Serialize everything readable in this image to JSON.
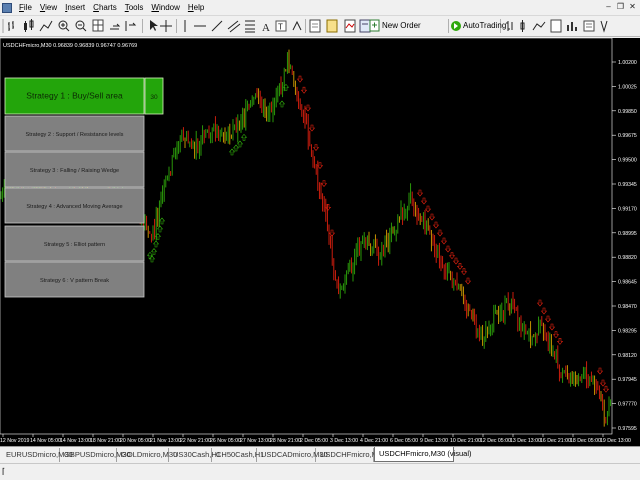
{
  "menu": {
    "items": [
      "File",
      "View",
      "Insert",
      "Charts",
      "Tools",
      "Window",
      "Help"
    ]
  },
  "toolbar": {
    "new_order_label": "New Order",
    "autotrading_label": "AutoTrading"
  },
  "chart": {
    "header_text": "USDCHFmicro,M30  0.96839 0.96839 0.96747 0.96769",
    "price_labels": [
      "1.00200",
      "1.00025",
      "0.99850",
      "0.99675",
      "0.99500",
      "0.99345",
      "0.99170",
      "0.98995",
      "0.98820",
      "0.98645",
      "0.98470",
      "0.98295",
      "0.98120",
      "0.97945",
      "0.97770",
      "0.97595"
    ],
    "time_labels": [
      "12 Nov 2019",
      "14 Nov 05:00",
      "14 Nov 13:00",
      "18 Nov 21:00",
      "20 Nov 05:00",
      "21 Nov 13:00",
      "22 Nov 21:00",
      "26 Nov 05:00",
      "27 Nov 13:00",
      "28 Nov 21:00",
      "2 Dec 05:00",
      "3 Dec 13:00",
      "4 Dec 21:00",
      "6 Dec 05:00",
      "9 Dec 13:00",
      "10 Dec 21:00",
      "12 Dec 05:00",
      "13 Dec 13:00",
      "16 Dec 21:00",
      "18 Dec 05:00",
      "19 Dec 13:00"
    ],
    "colors": {
      "bull": "#2ea80b",
      "bear": "#e0200f",
      "neutral": "#d8a000"
    }
  },
  "strategy_panel": {
    "strategies": [
      {
        "label": "Strategy 1 : Buy/Sell area",
        "active": true
      },
      {
        "label": "Strategy 2 : Support / Resistance levels",
        "active": false
      },
      {
        "label": "Strategy 3 : Falling / Raising Wedge",
        "active": false
      },
      {
        "label": "Strategy 4 : Advanced Moving Average",
        "active": false
      },
      {
        "label": "Strategy 5 : Elliot pattern",
        "active": false
      },
      {
        "label": "Strategy 6 : V pattern Break",
        "active": false
      }
    ],
    "side_value": "30",
    "colors": {
      "active": "#23a50b",
      "inactive": "#808080"
    }
  },
  "tabs": [
    {
      "label": "EURUSDmicro,M30",
      "active": false
    },
    {
      "label": "GBPUSDmicro,M30",
      "active": false
    },
    {
      "label": "GOLDmicro,M30",
      "active": false
    },
    {
      "label": "US30Cash,H1",
      "active": false
    },
    {
      "label": "CH50Cash,H1",
      "active": false
    },
    {
      "label": "USDCADmicro,M30",
      "active": false
    },
    {
      "label": "USDCHFmicro,M30",
      "active": false
    },
    {
      "label": "USDCHFmicro,M30 (visual)",
      "active": true
    }
  ]
}
